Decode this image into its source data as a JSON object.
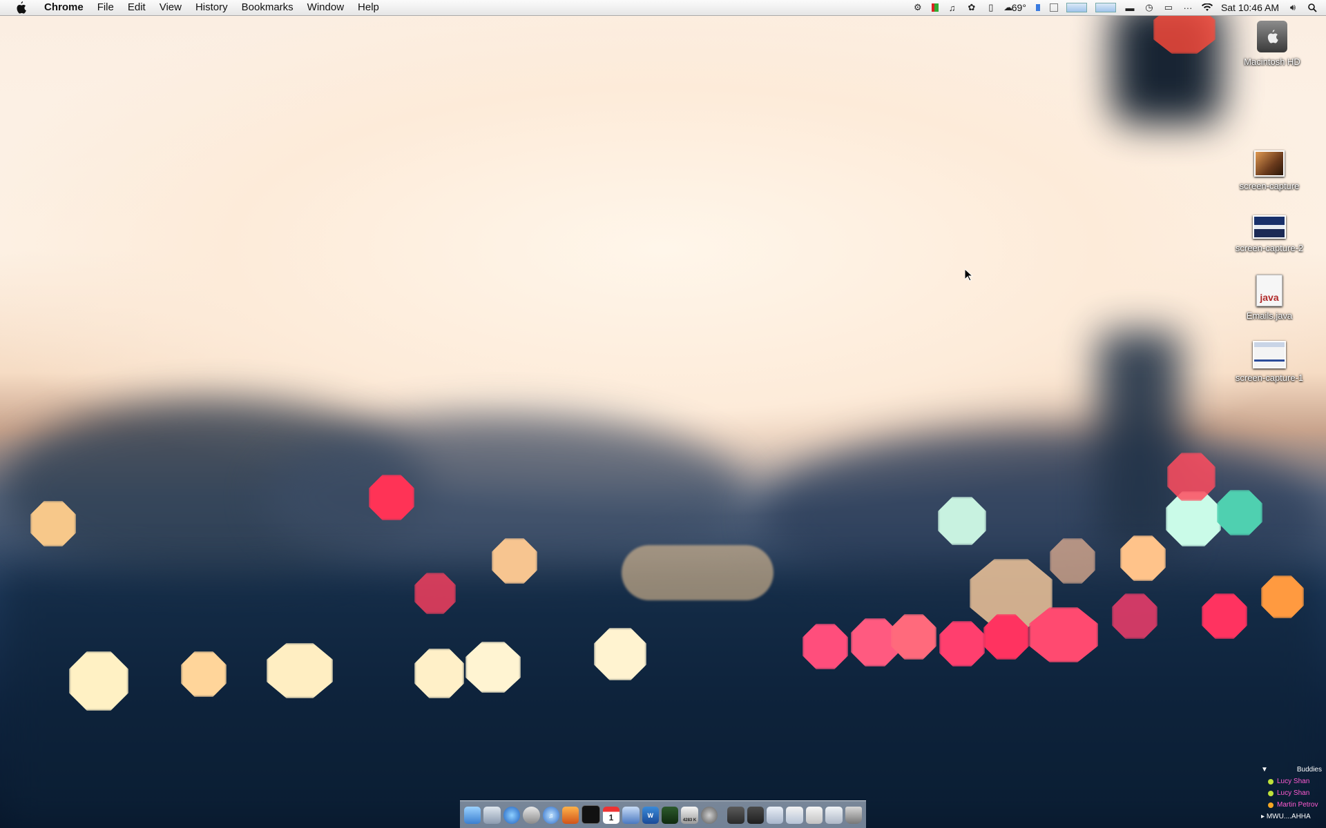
{
  "menubar": {
    "app_name": "Chrome",
    "menus": [
      "File",
      "Edit",
      "View",
      "History",
      "Bookmarks",
      "Window",
      "Help"
    ],
    "temperature": "69°",
    "clock": "Sat 10:46 AM",
    "status_icons": [
      "activity-monitor-icon",
      "battery-meter-icon",
      "music-icon",
      "paw-icon",
      "phone-icon",
      "weather-icon",
      "memory-icon",
      "cpu-icon",
      "network-graph-icon",
      "disk-graph-icon",
      "chat-icon",
      "time-machine-icon",
      "display-icon",
      "more-icon",
      "wifi-icon",
      "volume-icon",
      "spotlight-icon"
    ]
  },
  "desktop_icons": [
    {
      "name": "Macintosh HD",
      "type": "hard-drive-icon"
    },
    {
      "name": "screen-capture",
      "type": "image-thumbnail-icon"
    },
    {
      "name": "screen-capture-2",
      "type": "image-thumbnail-icon"
    },
    {
      "name": "Emails.java",
      "type": "java-file-icon",
      "badge": "java"
    },
    {
      "name": "screen-capture-1",
      "type": "image-thumbnail-icon"
    }
  ],
  "dock": {
    "items": [
      "finder-icon",
      "mail-icon",
      "safari-icon",
      "automator-icon",
      "itunes-icon",
      "vlc-icon",
      "terminal-icon",
      "calendar-icon",
      "preview-icon",
      "textedit-icon",
      "activity-icon",
      "counter-icon",
      "system-preferences-icon",
      "folder-icon",
      "downloads-icon",
      "document-icon",
      "window-icon",
      "window-icon-2",
      "window-icon-3",
      "trash-icon"
    ],
    "counter_label": "4283 K",
    "calendar_day": "1"
  },
  "buddies": {
    "title": "Buddies",
    "list": [
      "Lucy Shan",
      "Lucy Shan",
      "Martin Petrov"
    ],
    "group": "MWU....AHHA"
  }
}
